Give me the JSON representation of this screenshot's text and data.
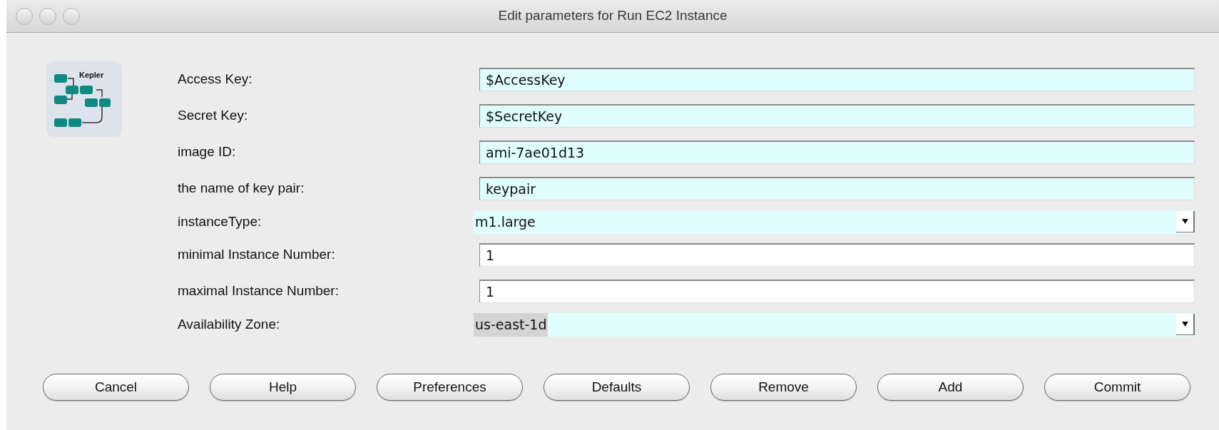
{
  "window": {
    "title": "Edit parameters for Run EC2 Instance"
  },
  "logo": {
    "label": "Kepler"
  },
  "parameters": [
    {
      "label": "Access Key:",
      "kind": "text",
      "value": "$AccessKey"
    },
    {
      "label": "Secret Key:",
      "kind": "text",
      "value": "$SecretKey"
    },
    {
      "label": "image ID:",
      "kind": "text",
      "value": "ami-7ae01d13"
    },
    {
      "label": "the name of key pair:",
      "kind": "text",
      "value": "keypair"
    },
    {
      "label": "instanceType:",
      "kind": "select",
      "value": "m1.large",
      "highlighted": false
    },
    {
      "label": "minimal Instance Number:",
      "kind": "number",
      "value": "1"
    },
    {
      "label": "maximal Instance Number:",
      "kind": "number",
      "value": "1"
    },
    {
      "label": "Availability Zone:",
      "kind": "select",
      "value": "us-east-1d",
      "highlighted": true
    }
  ],
  "buttons": [
    "Cancel",
    "Help",
    "Preferences",
    "Defaults",
    "Remove",
    "Add",
    "Commit"
  ]
}
